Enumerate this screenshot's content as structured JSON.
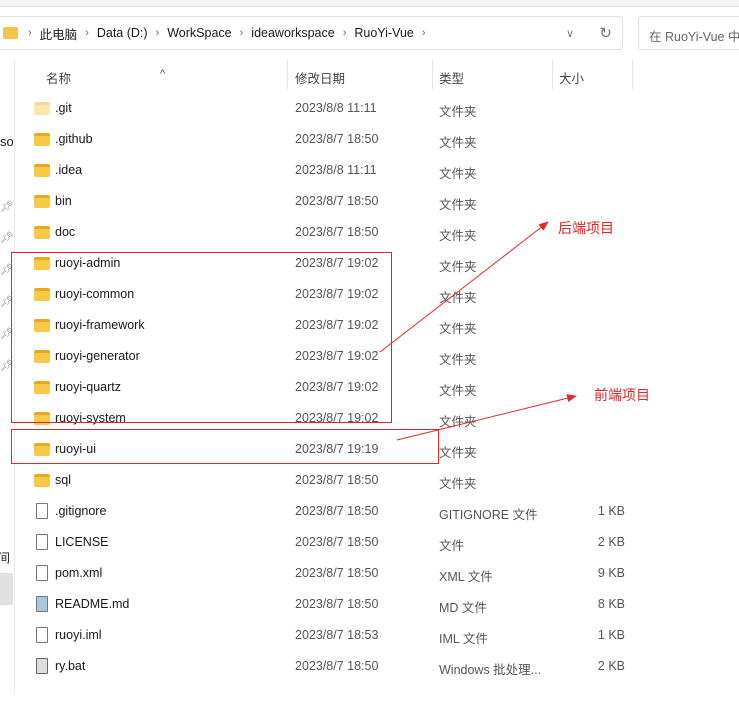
{
  "address": {
    "crumbs": [
      "此电脑",
      "Data (D:)",
      "WorkSpace",
      "ideaworkspace",
      "RuoYi-Vue"
    ]
  },
  "search": {
    "placeholder": "在 RuoYi-Vue 中搜索"
  },
  "sidebar": {
    "partial_text_1": "so",
    "partial_text_2": "间"
  },
  "columns": {
    "name": "名称",
    "date": "修改日期",
    "type": "类型",
    "size": "大小"
  },
  "files": [
    {
      "name": ".git",
      "date": "2023/8/8 11:11",
      "type": "文件夹",
      "size": "",
      "icon": "folder-hidden"
    },
    {
      "name": ".github",
      "date": "2023/8/7 18:50",
      "type": "文件夹",
      "size": "",
      "icon": "folder"
    },
    {
      "name": ".idea",
      "date": "2023/8/8 11:11",
      "type": "文件夹",
      "size": "",
      "icon": "folder"
    },
    {
      "name": "bin",
      "date": "2023/8/7 18:50",
      "type": "文件夹",
      "size": "",
      "icon": "folder"
    },
    {
      "name": "doc",
      "date": "2023/8/7 18:50",
      "type": "文件夹",
      "size": "",
      "icon": "folder"
    },
    {
      "name": "ruoyi-admin",
      "date": "2023/8/7 19:02",
      "type": "文件夹",
      "size": "",
      "icon": "folder"
    },
    {
      "name": "ruoyi-common",
      "date": "2023/8/7 19:02",
      "type": "文件夹",
      "size": "",
      "icon": "folder"
    },
    {
      "name": "ruoyi-framework",
      "date": "2023/8/7 19:02",
      "type": "文件夹",
      "size": "",
      "icon": "folder"
    },
    {
      "name": "ruoyi-generator",
      "date": "2023/8/7 19:02",
      "type": "文件夹",
      "size": "",
      "icon": "folder"
    },
    {
      "name": "ruoyi-quartz",
      "date": "2023/8/7 19:02",
      "type": "文件夹",
      "size": "",
      "icon": "folder"
    },
    {
      "name": "ruoyi-system",
      "date": "2023/8/7 19:02",
      "type": "文件夹",
      "size": "",
      "icon": "folder"
    },
    {
      "name": "ruoyi-ui",
      "date": "2023/8/7 19:19",
      "type": "文件夹",
      "size": "",
      "icon": "folder"
    },
    {
      "name": "sql",
      "date": "2023/8/7 18:50",
      "type": "文件夹",
      "size": "",
      "icon": "folder"
    },
    {
      "name": ".gitignore",
      "date": "2023/8/7 18:50",
      "type": "GITIGNORE 文件",
      "size": "1 KB",
      "icon": "file"
    },
    {
      "name": "LICENSE",
      "date": "2023/8/7 18:50",
      "type": "文件",
      "size": "2 KB",
      "icon": "file"
    },
    {
      "name": "pom.xml",
      "date": "2023/8/7 18:50",
      "type": "XML 文件",
      "size": "9 KB",
      "icon": "file"
    },
    {
      "name": "README.md",
      "date": "2023/8/7 18:50",
      "type": "MD 文件",
      "size": "8 KB",
      "icon": "markdown-file"
    },
    {
      "name": "ruoyi.iml",
      "date": "2023/8/7 18:53",
      "type": "IML 文件",
      "size": "1 KB",
      "icon": "file"
    },
    {
      "name": "ry.bat",
      "date": "2023/8/7 18:50",
      "type": "Windows 批处理...",
      "size": "2 KB",
      "icon": "batch-file"
    }
  ],
  "annotations": {
    "backend": "后端项目",
    "frontend": "前端项目",
    "color": "#e0282a"
  }
}
